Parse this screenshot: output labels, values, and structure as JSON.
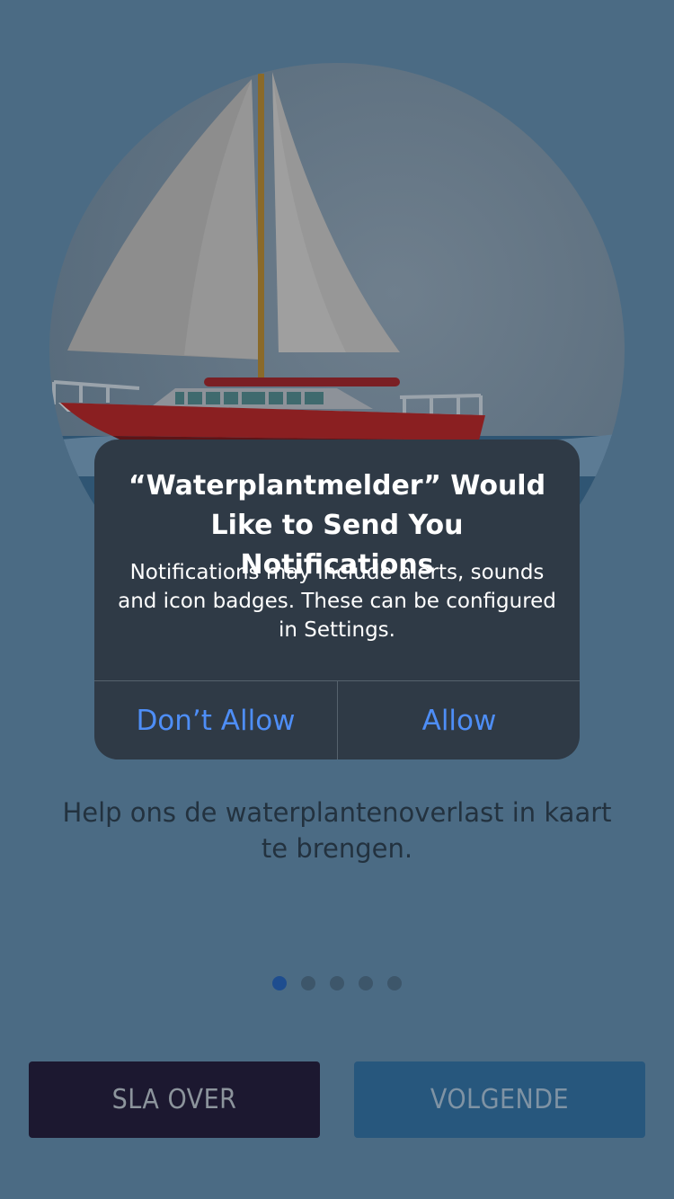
{
  "alert": {
    "title": "“Waterplantmelder” Would Like to Send You Notifications",
    "message": "Notifications may include alerts, sounds and icon badges. These can be configured in Settings.",
    "deny_label": "Don’t Allow",
    "allow_label": "Allow"
  },
  "onboarding": {
    "body_text": "Help ons de waterplantenoverlast in kaart te brengen.",
    "page_count": 5,
    "current_page": 1
  },
  "buttons": {
    "skip_label": "SLA OVER",
    "next_label": "VOLGENDE"
  },
  "colors": {
    "background": "#4b6b84",
    "alert_background": "#2f3a46",
    "alert_button_text": "#4e8ef7",
    "skip_button": "#1c1830",
    "next_button": "#27577d",
    "dot_active": "#1e4d8f",
    "dot_inactive": "#3d566a"
  }
}
